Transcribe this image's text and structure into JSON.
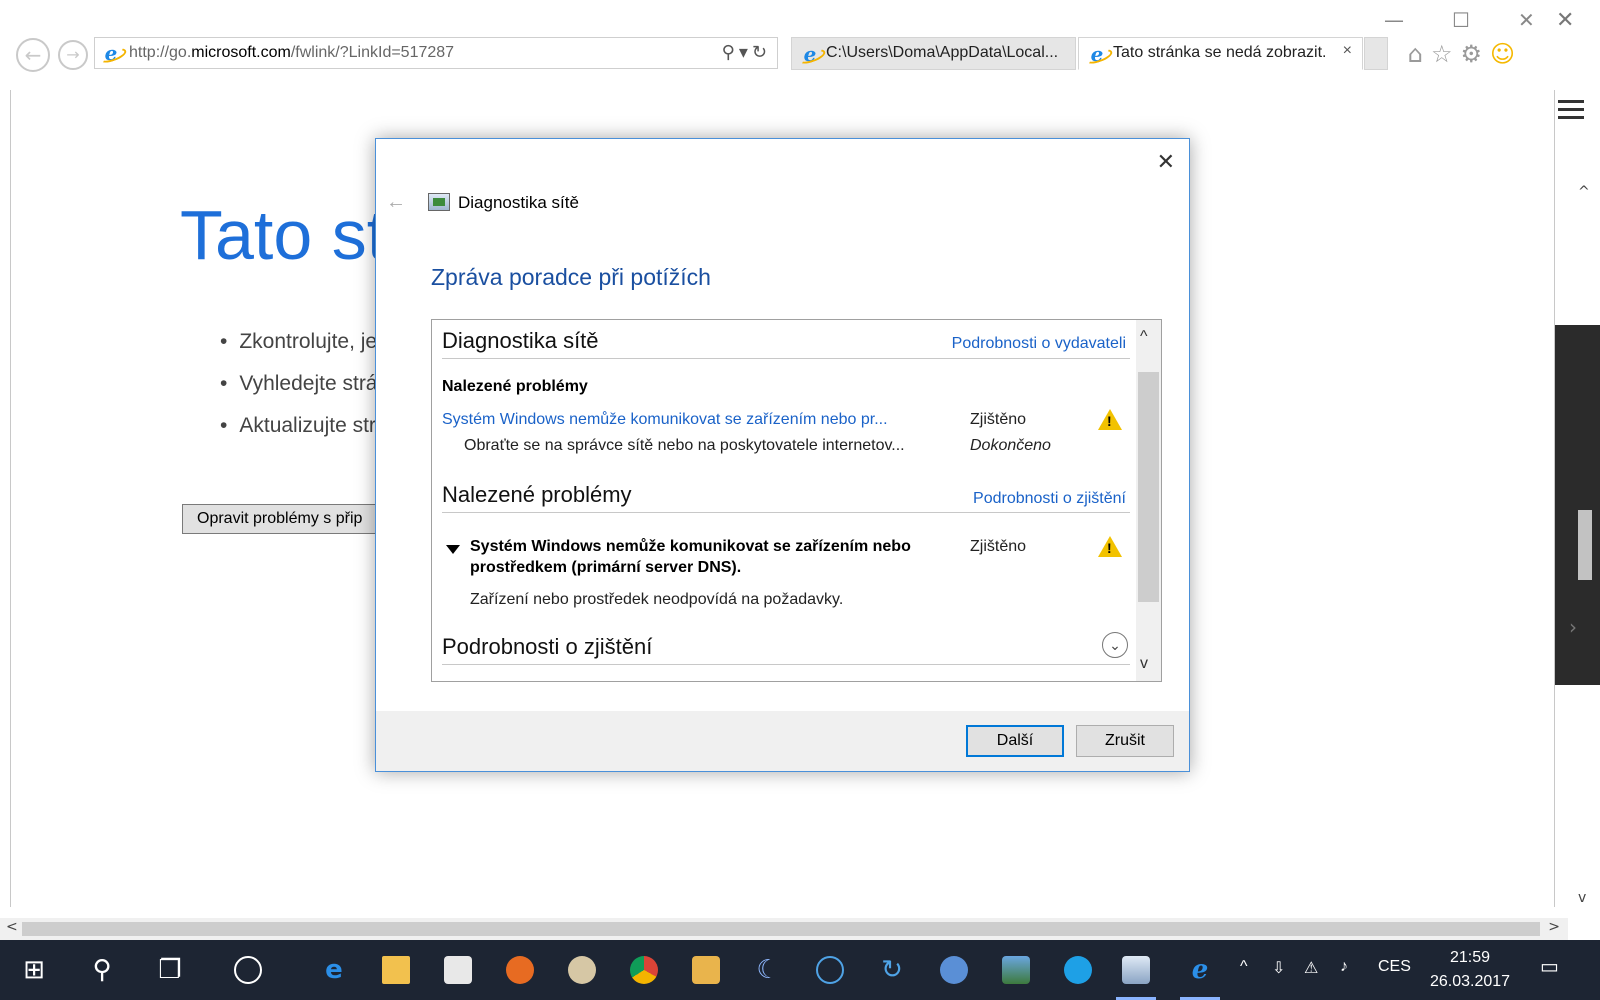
{
  "browser": {
    "url_prefix": "http://go.",
    "url_host": "microsoft.com",
    "url_path": "/fwlink/?LinkId=517287",
    "tabs": [
      {
        "label": "C:\\Users\\Doma\\AppData\\Local..."
      },
      {
        "label": "Tato stránka se nedá zobrazit."
      }
    ],
    "tab_close_glyph": "×"
  },
  "page": {
    "title": "Tato st",
    "bullets": [
      "Zkontrolujte, je",
      "Vyhledejte strá",
      "Aktualizujte str"
    ],
    "fix_button": "Opravit problémy s přip"
  },
  "dialog": {
    "app_title": "Diagnostika sítě",
    "heading": "Zpráva poradce při potížích",
    "section1": {
      "title": "Diagnostika sítě",
      "link": "Podrobnosti o vydavateli",
      "subheading": "Nalezené problémy",
      "issue": "Systém Windows nemůže komunikovat se zařízením nebo pr...",
      "issue_status": "Zjištěno",
      "resolution": "Obraťte se na správce sítě nebo na poskytovatele internetov...",
      "resolution_status": "Dokončeno"
    },
    "section2": {
      "title": "Nalezené problémy",
      "link": "Podrobnosti o zjištění",
      "issue": "Systém Windows nemůže komunikovat se zařízením nebo prostředkem (primární server DNS).",
      "issue_status": "Zjištěno",
      "description": "Zařízení nebo prostředek neodpovídá na požadavky."
    },
    "section3": {
      "title": "Podrobnosti o zjištění"
    },
    "buttons": {
      "next": "Další",
      "cancel": "Zrušit"
    }
  },
  "taskbar": {
    "language": "CES",
    "time": "21:59",
    "date": "26.03.2017",
    "icons": [
      "windows-start",
      "search",
      "task-view",
      "store-tiles",
      "edge",
      "file-explorer",
      "store",
      "firefox",
      "paint",
      "chrome",
      "mail",
      "moon-app",
      "app-blue",
      "app-refresh",
      "thunderbird",
      "photos",
      "skype",
      "network-diag",
      "internet-explorer"
    ]
  }
}
